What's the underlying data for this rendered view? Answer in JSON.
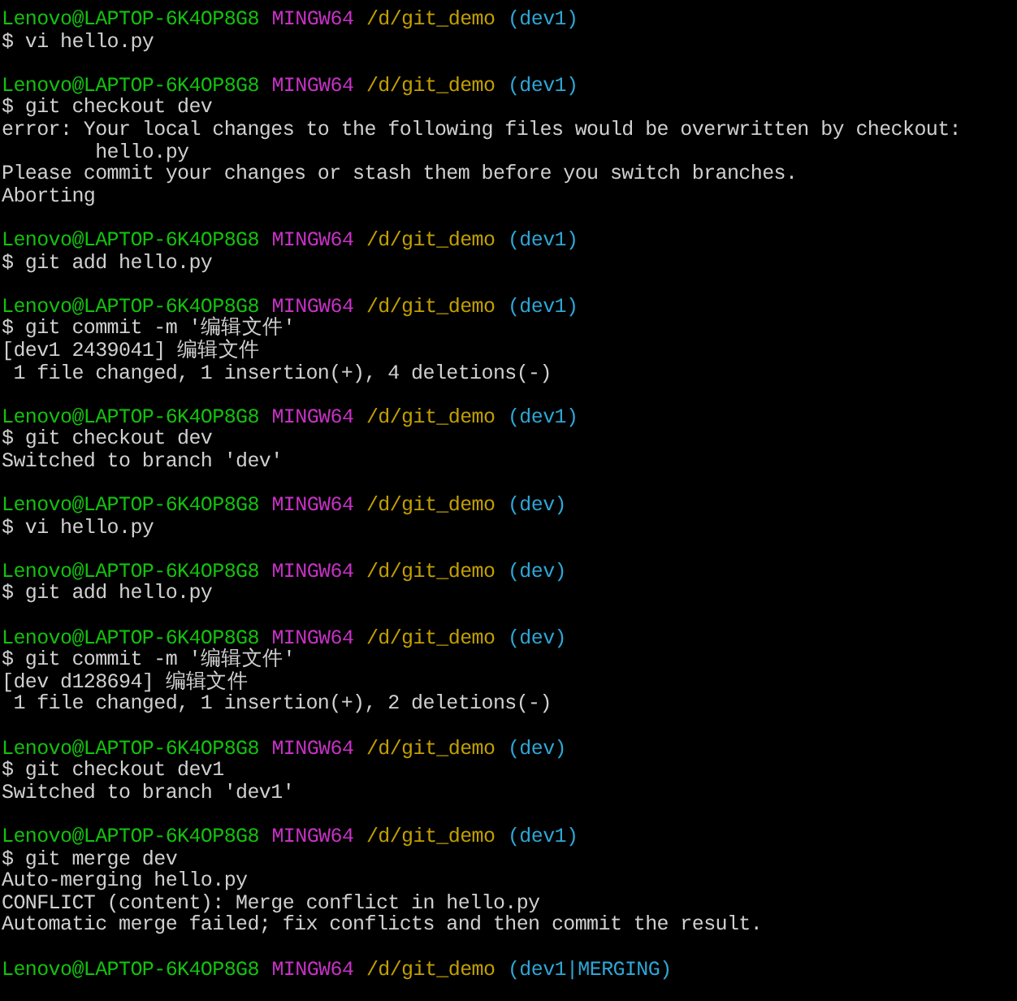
{
  "terminal": {
    "lines": [
      {
        "kind": "prompt",
        "user": "Lenovo@LAPTOP-6K4OP8G8",
        "system": "MINGW64",
        "path": "/d/git_demo",
        "branch": "(dev1)"
      },
      {
        "kind": "command",
        "text": "$ vi hello.py"
      },
      {
        "kind": "blank"
      },
      {
        "kind": "prompt",
        "user": "Lenovo@LAPTOP-6K4OP8G8",
        "system": "MINGW64",
        "path": "/d/git_demo",
        "branch": "(dev1)"
      },
      {
        "kind": "command",
        "text": "$ git checkout dev"
      },
      {
        "kind": "output",
        "text": "error: Your local changes to the following files would be overwritten by checkout:"
      },
      {
        "kind": "output",
        "text": "        hello.py"
      },
      {
        "kind": "output",
        "text": "Please commit your changes or stash them before you switch branches."
      },
      {
        "kind": "output",
        "text": "Aborting"
      },
      {
        "kind": "blank"
      },
      {
        "kind": "prompt",
        "user": "Lenovo@LAPTOP-6K4OP8G8",
        "system": "MINGW64",
        "path": "/d/git_demo",
        "branch": "(dev1)"
      },
      {
        "kind": "command",
        "text": "$ git add hello.py"
      },
      {
        "kind": "blank"
      },
      {
        "kind": "prompt",
        "user": "Lenovo@LAPTOP-6K4OP8G8",
        "system": "MINGW64",
        "path": "/d/git_demo",
        "branch": "(dev1)"
      },
      {
        "kind": "command",
        "text": "$ git commit -m '编辑文件'"
      },
      {
        "kind": "output",
        "text": "[dev1 2439041] 编辑文件"
      },
      {
        "kind": "output",
        "text": " 1 file changed, 1 insertion(+), 4 deletions(-)"
      },
      {
        "kind": "blank"
      },
      {
        "kind": "prompt",
        "user": "Lenovo@LAPTOP-6K4OP8G8",
        "system": "MINGW64",
        "path": "/d/git_demo",
        "branch": "(dev1)"
      },
      {
        "kind": "command",
        "text": "$ git checkout dev"
      },
      {
        "kind": "output",
        "text": "Switched to branch 'dev'"
      },
      {
        "kind": "blank"
      },
      {
        "kind": "prompt",
        "user": "Lenovo@LAPTOP-6K4OP8G8",
        "system": "MINGW64",
        "path": "/d/git_demo",
        "branch": "(dev)"
      },
      {
        "kind": "command",
        "text": "$ vi hello.py"
      },
      {
        "kind": "blank"
      },
      {
        "kind": "prompt",
        "user": "Lenovo@LAPTOP-6K4OP8G8",
        "system": "MINGW64",
        "path": "/d/git_demo",
        "branch": "(dev)"
      },
      {
        "kind": "command",
        "text": "$ git add hello.py"
      },
      {
        "kind": "blank"
      },
      {
        "kind": "prompt",
        "user": "Lenovo@LAPTOP-6K4OP8G8",
        "system": "MINGW64",
        "path": "/d/git_demo",
        "branch": "(dev)"
      },
      {
        "kind": "command",
        "text": "$ git commit -m '编辑文件'"
      },
      {
        "kind": "output",
        "text": "[dev d128694] 编辑文件"
      },
      {
        "kind": "output",
        "text": " 1 file changed, 1 insertion(+), 2 deletions(-)"
      },
      {
        "kind": "blank"
      },
      {
        "kind": "prompt",
        "user": "Lenovo@LAPTOP-6K4OP8G8",
        "system": "MINGW64",
        "path": "/d/git_demo",
        "branch": "(dev)"
      },
      {
        "kind": "command",
        "text": "$ git checkout dev1"
      },
      {
        "kind": "output",
        "text": "Switched to branch 'dev1'"
      },
      {
        "kind": "blank"
      },
      {
        "kind": "prompt",
        "user": "Lenovo@LAPTOP-6K4OP8G8",
        "system": "MINGW64",
        "path": "/d/git_demo",
        "branch": "(dev1)"
      },
      {
        "kind": "command",
        "text": "$ git merge dev"
      },
      {
        "kind": "output",
        "text": "Auto-merging hello.py"
      },
      {
        "kind": "output",
        "text": "CONFLICT (content): Merge conflict in hello.py"
      },
      {
        "kind": "output",
        "text": "Automatic merge failed; fix conflicts and then commit the result."
      },
      {
        "kind": "blank"
      },
      {
        "kind": "prompt",
        "user": "Lenovo@LAPTOP-6K4OP8G8",
        "system": "MINGW64",
        "path": "/d/git_demo",
        "branch": "(dev1|MERGING)"
      }
    ]
  }
}
